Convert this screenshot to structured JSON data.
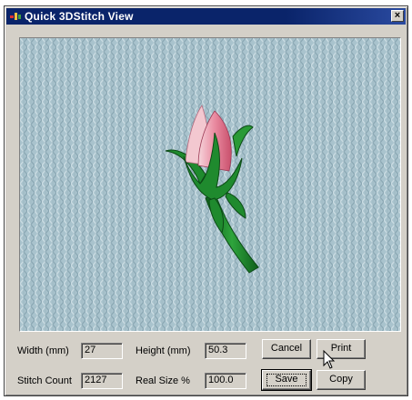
{
  "window": {
    "title": "Quick 3DStitch View",
    "close_label": "×"
  },
  "fields": {
    "width_label": "Width (mm)",
    "width_value": "27",
    "height_label": "Height (mm)",
    "height_value": "50.3",
    "stitch_count_label": "Stitch Count",
    "stitch_count_value": "2127",
    "real_size_label": "Real Size %",
    "real_size_value": "100.0"
  },
  "buttons": {
    "cancel": "Cancel",
    "print": "Print",
    "save": "Save",
    "copy": "Copy"
  },
  "colors": {
    "title_bar": "#0a246a",
    "dialog_face": "#d4d0c8",
    "fabric": "#a9c3cd",
    "leaf_green": "#1f8a2e",
    "petal_pink": "#e77c93",
    "petal_light": "#f3c8d0"
  },
  "icons": {
    "app": "app-logo-icon",
    "close": "close-icon",
    "cursor": "mouse-pointer-icon"
  }
}
